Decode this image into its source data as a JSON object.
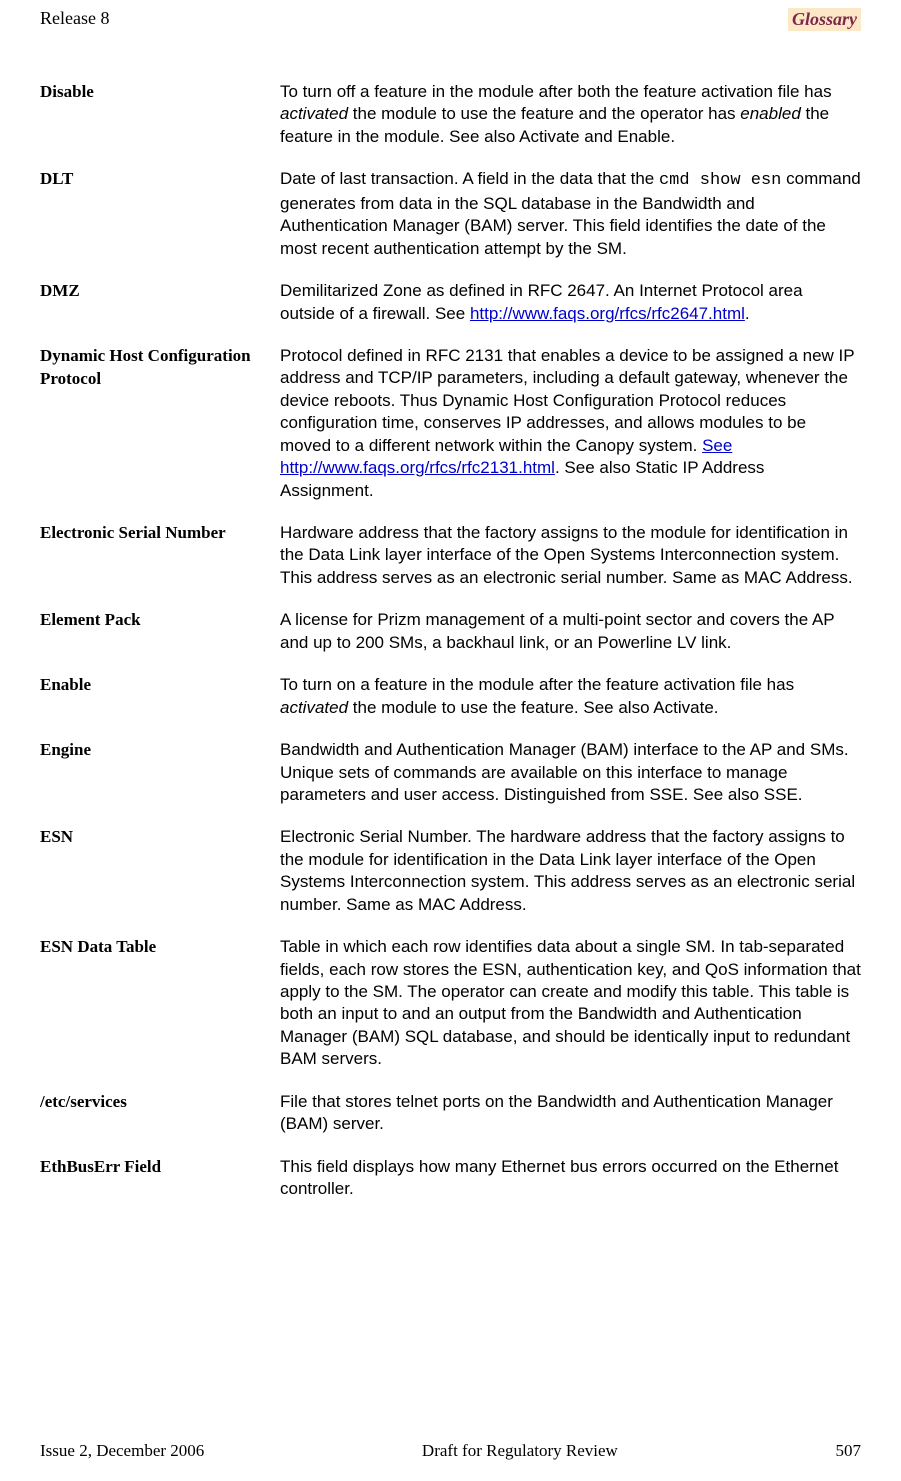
{
  "header": {
    "release": "Release 8",
    "section": "Glossary"
  },
  "entries": [
    {
      "term": "Disable",
      "definition_html": "To turn off a feature in the module after both the feature activation file has <em>activated</em> the module to use the feature and the operator has <em>enabled</em> the feature in the module. See also Activate and Enable."
    },
    {
      "term": "DLT",
      "definition_html": "Date of last transaction. A field in the data that the <code>cmd show esn</code> command generates from data in the SQL database in the Bandwidth and Authentication Manager (BAM) server. This field identifies the date of the most recent authentication attempt by the SM."
    },
    {
      "term": "DMZ",
      "definition_html": "Demilitarized Zone as defined in RFC 2647. An Internet Protocol area outside of a firewall. See <a class=\"link\" data-name=\"rfc2647-link\" data-interactable=\"true\">http://www.faqs.org/rfcs/rfc2647.html</a>."
    },
    {
      "term": "Dynamic Host Configuration Protocol",
      "definition_html": "Protocol defined in RFC 2131 that enables a device to be assigned a new IP address and TCP/IP parameters, including a default gateway, whenever the device reboots. Thus Dynamic Host Configuration Protocol reduces configuration time, conserves IP addresses, and allows modules to be moved to a different network within the Canopy system. <a class=\"link\" data-name=\"rfc2131-link\" data-interactable=\"true\">See http://www.faqs.org/rfcs/rfc2131.html</a>. See also Static IP Address Assignment."
    },
    {
      "term": "Electronic Serial Number",
      "definition_html": "Hardware address that the factory assigns to the module for identification in the Data Link layer interface of the Open Systems Interconnection system. This address serves as an electronic serial number. Same as MAC Address."
    },
    {
      "term": "Element Pack",
      "definition_html": "A license for Prizm management of a multi-point sector and covers the AP and up to 200 SMs, a backhaul link, or an Powerline LV link."
    },
    {
      "term": "Enable",
      "definition_html": "To turn on a feature in the module after the feature activation file has <em>activated</em> the module to use the feature. See also Activate."
    },
    {
      "term": "Engine",
      "definition_html": "Bandwidth and Authentication Manager (BAM) interface to the AP and SMs. Unique sets of commands are available on this interface to manage parameters and user access. Distinguished from SSE. See also SSE."
    },
    {
      "term": "ESN",
      "definition_html": "Electronic Serial Number. The hardware address that the factory assigns to the module for identification in the Data Link layer interface of the Open Systems Interconnection system. This address serves as an electronic serial number. Same as MAC Address."
    },
    {
      "term": "ESN Data Table",
      "definition_html": "Table in which each row identifies data about a single SM. In tab-separated fields, each row stores the ESN, authentication key, and QoS information that apply to the SM. The operator can create and modify this table. This table is both an input to and an output from the Bandwidth and Authentication Manager (BAM) SQL database, and should be identically input to redundant BAM servers."
    },
    {
      "term": "/etc/services",
      "definition_html": "File that stores telnet ports on the Bandwidth and Authentication Manager (BAM) server."
    },
    {
      "term": "EthBusErr Field",
      "definition_html": "This field displays how many Ethernet bus errors occurred on the Ethernet controller."
    }
  ],
  "footer": {
    "left": "Issue 2, December 2006",
    "center": "Draft for Regulatory Review",
    "right": "507"
  }
}
